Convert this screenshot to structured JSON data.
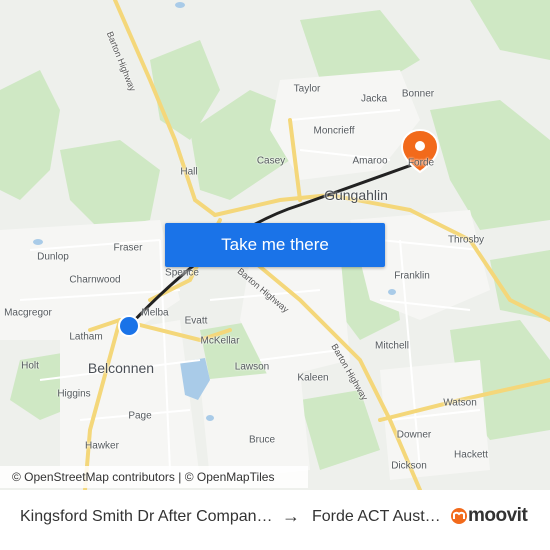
{
  "map": {
    "places": [
      {
        "name": "Taylor"
      },
      {
        "name": "Jacka"
      },
      {
        "name": "Bonner"
      },
      {
        "name": "Moncrieff"
      },
      {
        "name": "Casey"
      },
      {
        "name": "Amaroo"
      },
      {
        "name": "Forde"
      },
      {
        "name": "Hall"
      },
      {
        "name": "Gungahlin"
      },
      {
        "name": "Dunlop"
      },
      {
        "name": "Fraser"
      },
      {
        "name": "Charnwood"
      },
      {
        "name": "Spence"
      },
      {
        "name": "Throsby"
      },
      {
        "name": "Franklin"
      },
      {
        "name": "Macgregor"
      },
      {
        "name": "Melba"
      },
      {
        "name": "Evatt"
      },
      {
        "name": "Latham"
      },
      {
        "name": "McKellar"
      },
      {
        "name": "Mitchell"
      },
      {
        "name": "Holt"
      },
      {
        "name": "Belconnen"
      },
      {
        "name": "Lawson"
      },
      {
        "name": "Kaleen"
      },
      {
        "name": "Higgins"
      },
      {
        "name": "Watson"
      },
      {
        "name": "Page"
      },
      {
        "name": "Downer"
      },
      {
        "name": "Hawker"
      },
      {
        "name": "Bruce"
      },
      {
        "name": "Hackett"
      },
      {
        "name": "Dickson"
      }
    ],
    "highway_labels": [
      "Barton Highway",
      "Barton Highway",
      "Barton Highway"
    ],
    "route_color": "#222222",
    "origin_marker_color": "#1a73e8",
    "destination_marker_color": "#f26a1b",
    "marker_icons": [
      "location-dot-icon",
      "map-pin-icon"
    ]
  },
  "cta": {
    "label": "Take me there",
    "color": "#1a73e8"
  },
  "attribution": "© OpenStreetMap contributors | © OpenMapTiles",
  "footer": {
    "origin": "Kingsford Smith Dr After Companion Cr",
    "arrow": "→",
    "destination": "Forde ACT Australia",
    "brand": "moovit",
    "brand_color": "#f26a1b"
  }
}
